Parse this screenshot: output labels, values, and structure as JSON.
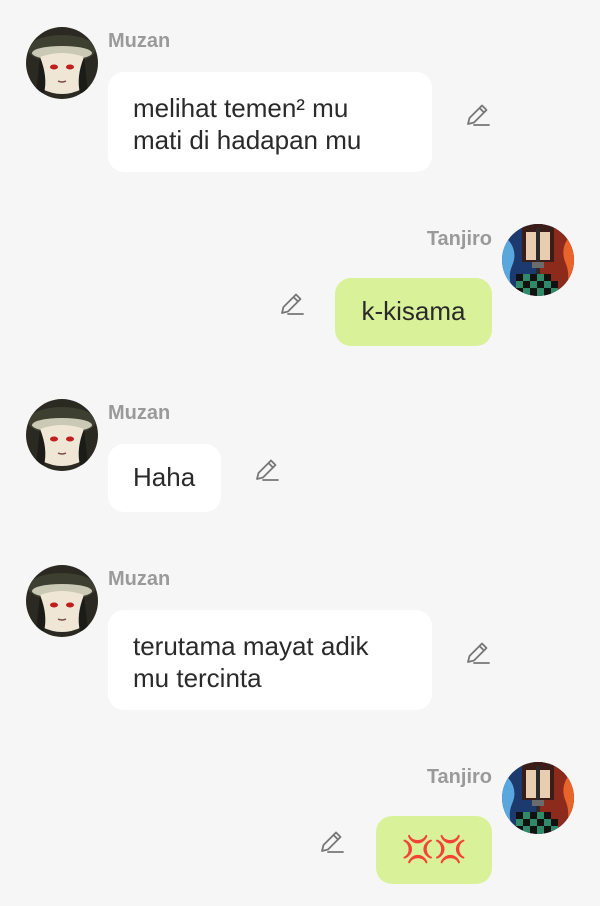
{
  "messages": [
    {
      "sender": "Muzan",
      "side": "left",
      "text": "melihat temen² mu\nmati di hadapan mu"
    },
    {
      "sender": "Tanjiro",
      "side": "right",
      "text": "k-kisama"
    },
    {
      "sender": "Muzan",
      "side": "left",
      "text": "Haha"
    },
    {
      "sender": "Muzan",
      "side": "left",
      "text": "terutama mayat adik\nmu tercinta"
    },
    {
      "sender": "Tanjiro",
      "side": "right",
      "text": "💢💢"
    }
  ],
  "icons": {
    "edit": "pencil-edit-icon",
    "muzan_avatar": "muzan-avatar",
    "tanjiro_avatar": "tanjiro-avatar"
  },
  "colors": {
    "background": "#f6f6f6",
    "left_bubble": "#ffffff",
    "right_bubble": "#d9f29a",
    "name": "#9a9a9a",
    "text": "#2a2a2a"
  }
}
